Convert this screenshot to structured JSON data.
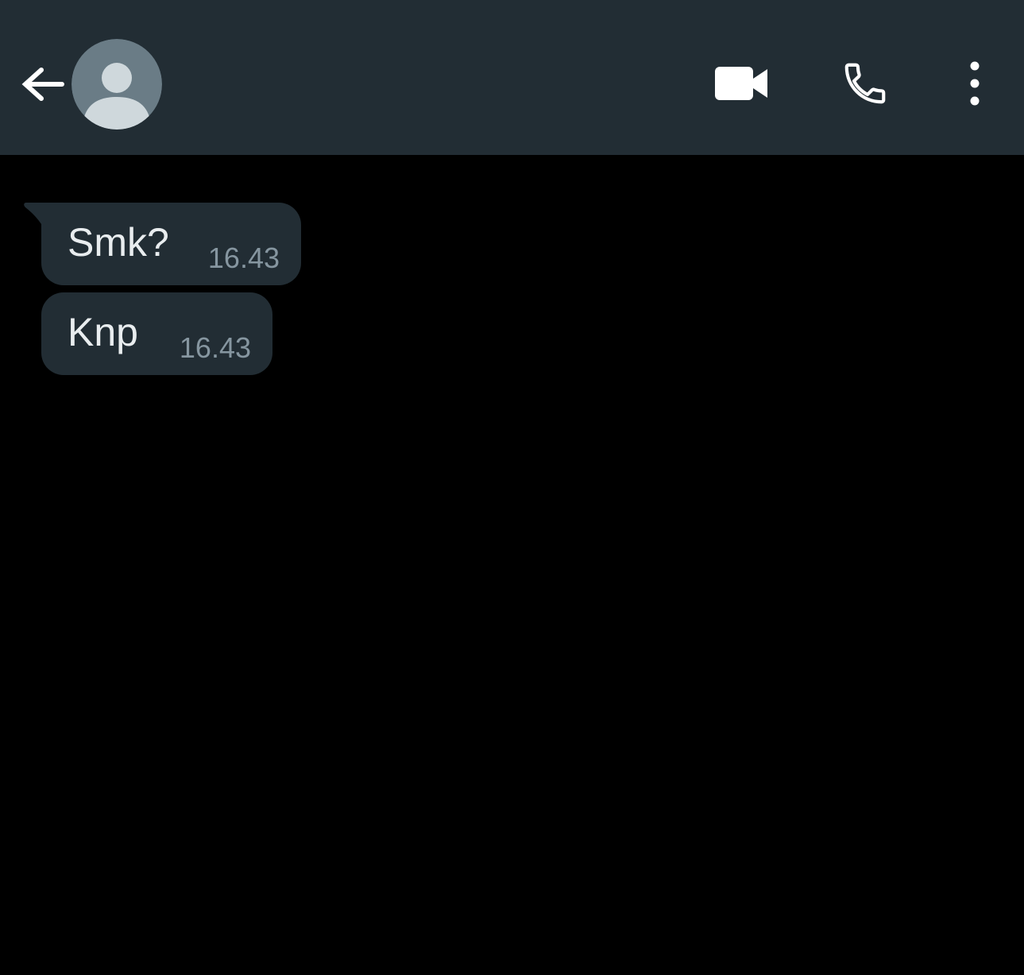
{
  "header": {
    "back_icon": "arrow-left-icon",
    "avatar_icon": "default-avatar-icon",
    "video_icon": "video-camera-icon",
    "call_icon": "phone-icon",
    "menu_icon": "more-vertical-icon"
  },
  "colors": {
    "header_bg": "#222d34",
    "chat_bg": "#000000",
    "bubble_bg": "#222d34",
    "message_text": "#e9edef",
    "timestamp_text": "#8696a0",
    "icon_color": "#ffffff",
    "avatar_bg": "#6a7c86",
    "avatar_figure": "#cfd8dc"
  },
  "messages": [
    {
      "text": "Smk?",
      "time": "16.43"
    },
    {
      "text": "Knp",
      "time": "16.43"
    }
  ]
}
